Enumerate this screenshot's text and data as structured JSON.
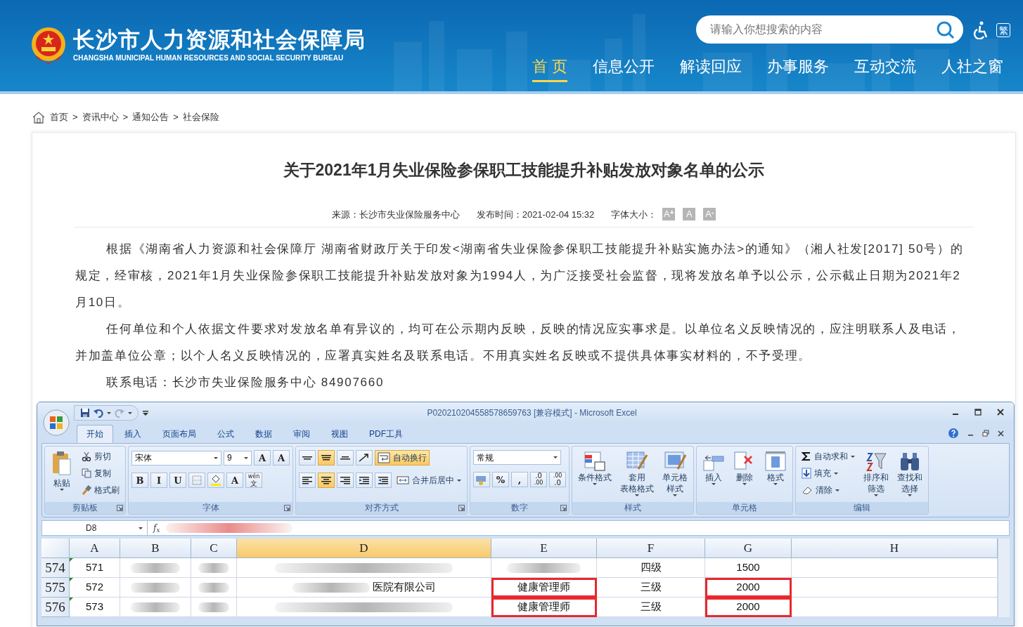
{
  "header": {
    "site_title": "长沙市人力资源和社会保障局",
    "site_subtitle": "CHANGSHA MUNICIPAL HUMAN RESOURCES AND SOCIAL SECURITY BUREAU",
    "search": {
      "placeholder": "请输入你想搜索的内容"
    },
    "traditional_button": "繁",
    "nav": [
      {
        "label": "首 页",
        "selected": true
      },
      {
        "label": "信息公开",
        "selected": false
      },
      {
        "label": "解读回应",
        "selected": false
      },
      {
        "label": "办事服务",
        "selected": false
      },
      {
        "label": "互动交流",
        "selected": false
      },
      {
        "label": "人社之窗",
        "selected": false
      }
    ]
  },
  "breadcrumb": [
    "首页",
    "资讯中心",
    "通知公告",
    "社会保险"
  ],
  "breadcrumb_separator": ">",
  "article": {
    "title": "关于2021年1月失业保险参保职工技能提升补贴发放对象名单的公示",
    "meta": [
      {
        "kind": "text",
        "text": "来源：长沙市失业保险服务中心"
      },
      {
        "kind": "text",
        "text": "发布时间：2021-02-04 15:32"
      },
      {
        "kind": "text",
        "text": "字体大小："
      },
      {
        "kind": "fontsize",
        "text": "A$^{+}$"
      },
      {
        "kind": "fontsize",
        "text": "A"
      },
      {
        "kind": "fontsize",
        "text": "A$^{-}$"
      }
    ],
    "paragraphs": [
      "根据《湖南省人力资源和社会保障厅 湖南省财政厅关于印发<湖南省失业保险参保职工技能提升补贴实施办法>的通知》（湘人社发[2017] 50号）的规定，经审核，2021年1月失业保险参保职工技能提升补贴发放对象为1994人，为广泛接受社会监督，现将发放名单予以公示，公示截止日期为2021年2月10日。",
      "任何单位和个人依据文件要求对发放名单有异议的，均可在公示期内反映，反映的情况应实事求是。以单位名义反映情况的，应注明联系人及电话，并加盖单位公章；以个人名义反映情况的，应署真实姓名及联系电话。不用真实姓名反映或不提供具体事实材料的，不予受理。",
      "联系电话：长沙市失业保险服务中心  84907660"
    ]
  },
  "excel": {
    "window_title": "P020210204558578659763  [兼容模式] - Microsoft Excel",
    "tabs": [
      {
        "label": "开始",
        "selected": true
      },
      {
        "label": "插入",
        "selected": false
      },
      {
        "label": "页面布局",
        "selected": false
      },
      {
        "label": "公式",
        "selected": false
      },
      {
        "label": "数据",
        "selected": false
      },
      {
        "label": "审阅",
        "selected": false
      },
      {
        "label": "视图",
        "selected": false
      },
      {
        "label": "PDF工具",
        "selected": false
      }
    ],
    "groups": [
      {
        "title": "剪贴板",
        "launcher": true,
        "columns": [
          [
            {
              "kind": "large",
              "lines": [
                "粘贴"
              ],
              "dropdown": true
            }
          ],
          [
            {
              "kind": "small",
              "label": "剪切",
              "dropdown": false
            },
            {
              "kind": "small",
              "label": "复制",
              "dropdown": false
            },
            {
              "kind": "small",
              "label": "格式刷",
              "dropdown": false
            }
          ]
        ]
      },
      {
        "title": "字体",
        "launcher": true,
        "rows": [
          [
            {
              "kind": "field",
              "value": "宋体"
            },
            {
              "kind": "field",
              "value": "9"
            },
            {
              "kind": "glyph",
              "lines": [
                "A"
              ],
              "selected": false
            },
            {
              "kind": "glyph",
              "lines": [
                "A"
              ],
              "selected": false
            }
          ],
          [
            {
              "kind": "glyph",
              "lines": [
                "B"
              ],
              "selected": false
            },
            {
              "kind": "glyph",
              "lines": [
                "I"
              ],
              "selected": false
            },
            {
              "kind": "glyph",
              "lines": [
                "U"
              ],
              "selected": false
            },
            {
              "kind": "iconbtn",
              "selected": false
            },
            {
              "kind": "iconbtn",
              "selected": false
            },
            {
              "kind": "glyph",
              "lines": [
                "A"
              ],
              "selected": false
            },
            {
              "kind": "glyph",
              "lines": [
                "wén",
                "文"
              ],
              "selected": false
            }
          ]
        ]
      },
      {
        "title": "对齐方式",
        "launcher": true,
        "rows": [
          [
            {
              "kind": "iconbtn",
              "selected": false
            },
            {
              "kind": "iconbtn",
              "selected": true
            },
            {
              "kind": "iconbtn",
              "selected": false
            },
            {
              "kind": "iconbtn",
              "selected": false
            },
            {
              "kind": "small",
              "label": "自动换行",
              "dropdown": false,
              "selected": true
            }
          ],
          [
            {
              "kind": "iconbtn",
              "selected": false
            },
            {
              "kind": "iconbtn",
              "selected": true
            },
            {
              "kind": "iconbtn",
              "selected": false
            },
            {
              "kind": "iconbtn",
              "selected": false
            },
            {
              "kind": "iconbtn",
              "selected": false
            },
            {
              "kind": "small",
              "label": "合并后居中",
              "dropdown": true,
              "selected": false
            }
          ]
        ]
      },
      {
        "title": "数字",
        "launcher": true,
        "rows": [
          [
            {
              "kind": "field",
              "value": "常规"
            }
          ],
          [
            {
              "kind": "iconbtn",
              "selected": false
            },
            {
              "kind": "glyph",
              "lines": [
                "%"
              ],
              "selected": false
            },
            {
              "kind": "glyph",
              "lines": [
                ","
              ],
              "selected": false
            },
            {
              "kind": "glyph",
              "lines": [
                ".0",
                ".00"
              ],
              "selected": false
            },
            {
              "kind": "glyph",
              "lines": [
                ".00",
                ".0"
              ],
              "selected": false
            }
          ]
        ]
      },
      {
        "title": "样式",
        "launcher": false,
        "columns": [
          [
            {
              "kind": "large",
              "lines": [
                "条件格式"
              ],
              "dropdown": true
            }
          ],
          [
            {
              "kind": "large",
              "lines": [
                "套用",
                "表格格式"
              ],
              "dropdown": true
            }
          ],
          [
            {
              "kind": "large",
              "lines": [
                "单元格",
                "样式"
              ],
              "dropdown": true
            }
          ]
        ]
      },
      {
        "title": "单元格",
        "launcher": false,
        "columns": [
          [
            {
              "kind": "large",
              "lines": [
                "插入"
              ],
              "dropdown": true
            }
          ],
          [
            {
              "kind": "large",
              "lines": [
                "删除"
              ],
              "dropdown": true
            }
          ],
          [
            {
              "kind": "large",
              "lines": [
                "格式"
              ],
              "dropdown": true
            }
          ]
        ]
      },
      {
        "title": "编辑",
        "launcher": false,
        "columns": [
          [
            {
              "kind": "small",
              "label": "自动求和",
              "dropdown": true
            },
            {
              "kind": "small",
              "label": "填充",
              "dropdown": true
            },
            {
              "kind": "small",
              "label": "清除",
              "dropdown": true
            }
          ],
          [
            {
              "kind": "large",
              "lines": [
                "排序和",
                "筛选"
              ],
              "dropdown": true
            }
          ],
          [
            {
              "kind": "large",
              "lines": [
                "查找和",
                "选择"
              ],
              "dropdown": true
            }
          ]
        ]
      }
    ],
    "name_box": "D8",
    "fx": "f$_{x}$",
    "columns": [
      {
        "label": "A",
        "selected": false
      },
      {
        "label": "B",
        "selected": false
      },
      {
        "label": "C",
        "selected": false
      },
      {
        "label": "D",
        "selected": true
      },
      {
        "label": "E",
        "selected": false
      },
      {
        "label": "F",
        "selected": false
      },
      {
        "label": "G",
        "selected": false
      },
      {
        "label": "H",
        "selected": false
      }
    ],
    "rows": [
      {
        "number": "574",
        "cells": [
          {
            "text": "571"
          },
          {
            "redacted": true
          },
          {
            "redacted": true
          },
          {
            "redacted": true
          },
          {
            "redacted": true
          },
          {
            "text": "四级"
          },
          {
            "text": "1500"
          }
        ]
      },
      {
        "number": "575",
        "cells": [
          {
            "text": "572"
          },
          {
            "redacted": true
          },
          {
            "redacted": true
          },
          {
            "redacted": true,
            "text": "医院有限公司"
          },
          {
            "text": "健康管理师",
            "highlighted": true
          },
          {
            "text": "三级"
          },
          {
            "text": "2000",
            "highlighted": true
          }
        ]
      },
      {
        "number": "576",
        "cells": [
          {
            "text": "573"
          },
          {
            "redacted": true
          },
          {
            "redacted": true
          },
          {
            "redacted": true
          },
          {
            "text": "健康管理师",
            "highlighted": true
          },
          {
            "text": "三级"
          },
          {
            "text": "2000",
            "highlighted": true
          }
        ]
      }
    ]
  }
}
